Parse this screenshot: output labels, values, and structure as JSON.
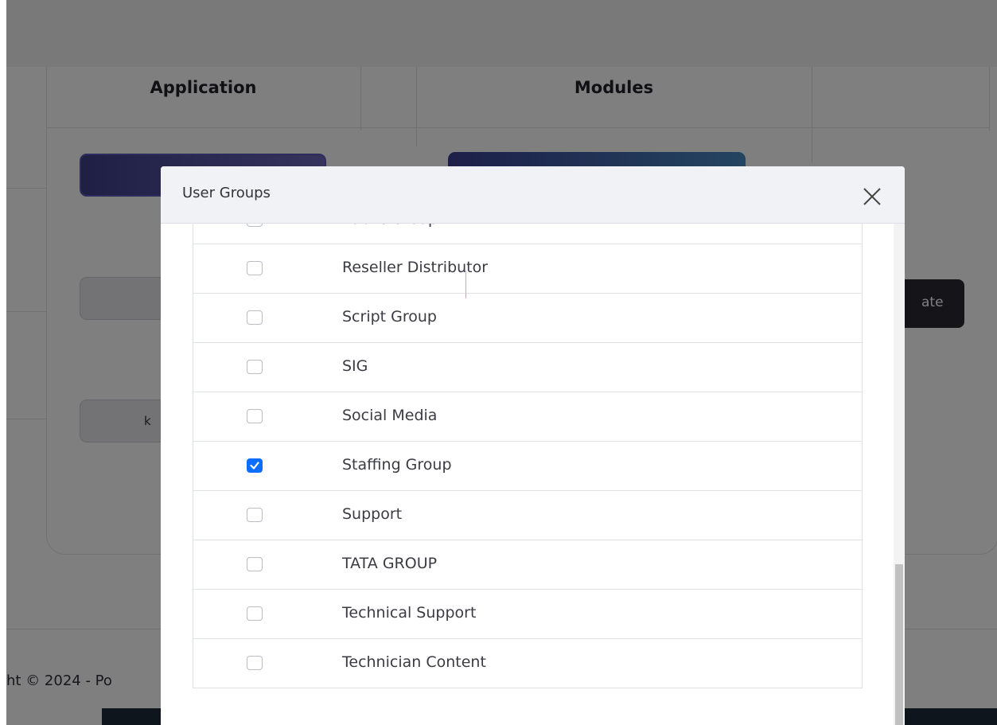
{
  "background": {
    "columns": {
      "application": "Application",
      "modules": "Modules"
    },
    "buttons": {
      "grey_2_partial": "k",
      "dark_partial": "ate"
    },
    "footer": {
      "copyright_partial": "ht © 2024 - Po"
    }
  },
  "modal": {
    "title": "User Groups",
    "close_icon": "close-icon",
    "items": [
      {
        "label": "Public Group",
        "checked": false
      },
      {
        "label": "Reseller Distributor",
        "checked": false
      },
      {
        "label": "Script Group",
        "checked": false
      },
      {
        "label": "SIG",
        "checked": false
      },
      {
        "label": "Social Media",
        "checked": false
      },
      {
        "label": "Staffing Group",
        "checked": true
      },
      {
        "label": "Support",
        "checked": false
      },
      {
        "label": "TATA GROUP",
        "checked": false
      },
      {
        "label": "Technical Support",
        "checked": false
      },
      {
        "label": "Technician Content",
        "checked": false
      }
    ]
  },
  "colors": {
    "checkbox_checked": "#0d6efd",
    "overlay": "rgba(0,0,0,0.5)"
  }
}
